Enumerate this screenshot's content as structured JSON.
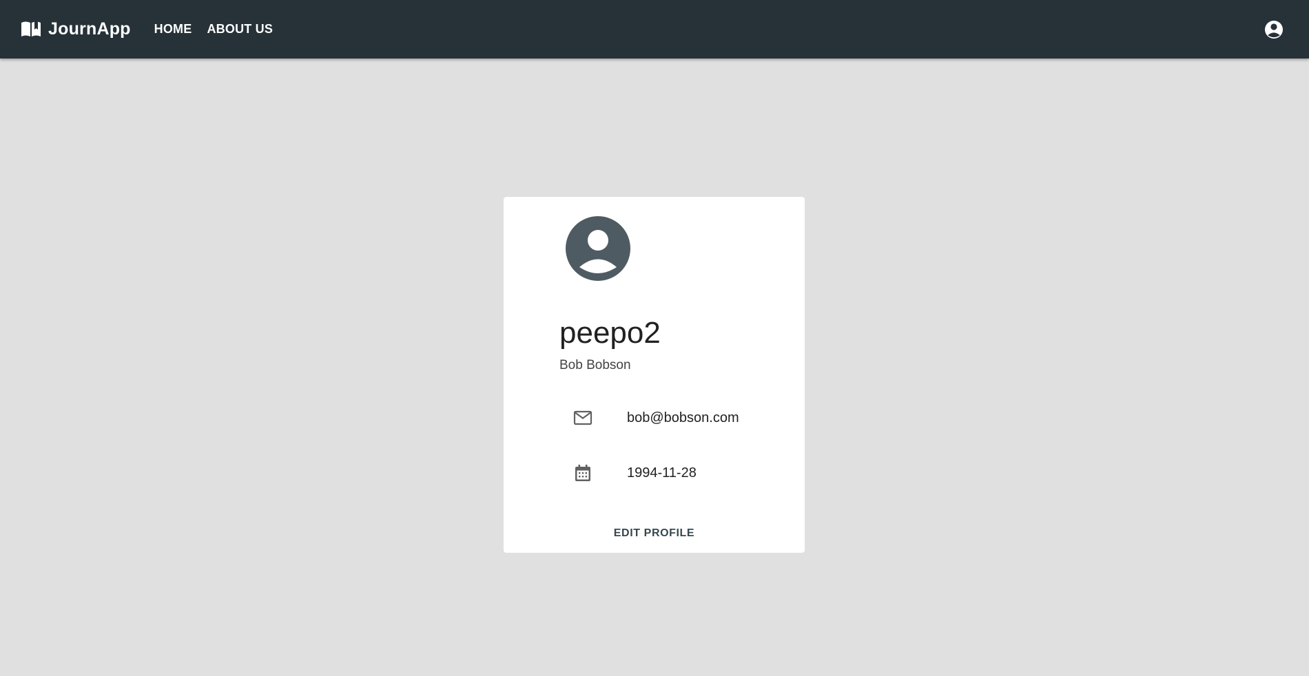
{
  "app_bar": {
    "brand": {
      "icon": "book-icon",
      "name": "JournApp"
    },
    "nav": [
      {
        "label": "HOME"
      },
      {
        "label": "ABOUT US"
      }
    ],
    "account_icon": "account-circle-icon",
    "background": "#263238"
  },
  "profile": {
    "avatar_icon": "account-circle-icon",
    "username": "peepo2",
    "full_name": "Bob Bobson",
    "email": {
      "icon": "mail-icon",
      "value": "bob@bobson.com"
    },
    "birthdate": {
      "icon": "calendar-icon",
      "value": "1994-11-28"
    },
    "edit_label": "EDIT PROFILE"
  },
  "colors": {
    "page_background": "#e0e0e0",
    "card_background": "#ffffff",
    "avatar": "#4f5b62",
    "edit_button_text": "#37474f"
  }
}
